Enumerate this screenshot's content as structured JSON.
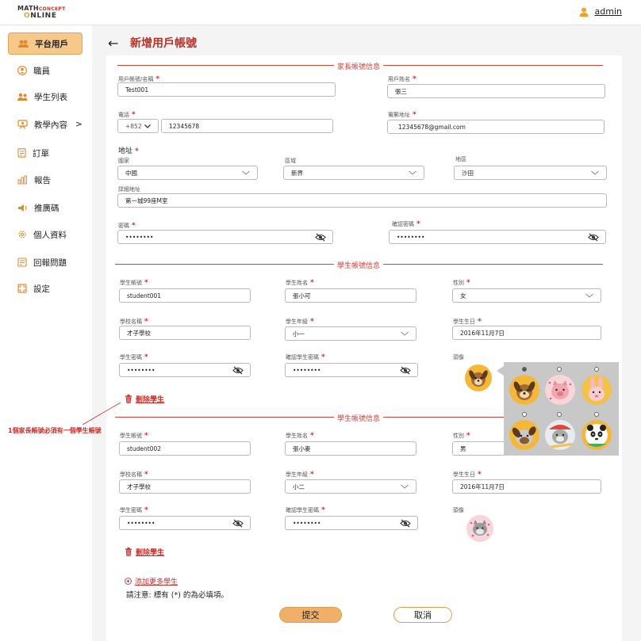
{
  "header": {
    "logo_line1_a": "MATH",
    "logo_line1_b": "CONCEPT",
    "logo_line2": "NLINE",
    "logo_line2_o": "O",
    "user_name": "admin"
  },
  "sidebar": {
    "items": [
      {
        "label": "平台用戶",
        "icon": "users-icon"
      },
      {
        "label": "職員",
        "icon": "staff-icon"
      },
      {
        "label": "學生列表",
        "icon": "students-icon"
      },
      {
        "label": "教學內容",
        "icon": "teaching-icon",
        "suffix": ">"
      },
      {
        "label": "訂單",
        "icon": "order-icon"
      },
      {
        "label": "報告",
        "icon": "report-icon"
      },
      {
        "label": "推廣碼",
        "icon": "promo-icon"
      },
      {
        "label": "個人資料",
        "icon": "profile-icon"
      },
      {
        "label": "回報問題",
        "icon": "feedback-icon"
      },
      {
        "label": "設定",
        "icon": "settings-icon"
      }
    ]
  },
  "page": {
    "back": "←",
    "title": "新增用戶帳號"
  },
  "parent": {
    "section_title": "家長帳號信息",
    "account_label": "用戶帳號/名稱",
    "account_value": "Test001",
    "name_label": "用戶姓名",
    "name_value": "張三",
    "phone_label": "電話",
    "phone_code": "+852",
    "phone_value": "12345678",
    "email_label": "電郵地址",
    "email_value": "12345678@gmail.com",
    "address_label": "地址",
    "country_label": "國家",
    "country_value": "中國",
    "region_label": "區域",
    "region_value": "新界",
    "district_label": "地區",
    "district_value": "沙田",
    "detail_label": "詳細地址",
    "detail_value": "第一城99座M室",
    "password_label": "密碼",
    "password_value": "••••••••",
    "confirm_label": "確認密碼",
    "confirm_value": "••••••••"
  },
  "students": [
    {
      "section_title": "學生帳號信息",
      "account_label": "學生帳號",
      "account_value": "student001",
      "name_label": "學生姓名",
      "name_value": "張小可",
      "gender_label": "性別",
      "gender_value": "女",
      "school_label": "學校名稱",
      "school_value": "才子學校",
      "grade_label": "學生年級",
      "grade_value": "小一",
      "birthday_label": "學生生日",
      "birthday_value": "2016年11月7日",
      "password_label": "學生密碼",
      "password_value": "••••••••",
      "confirm_label": "確認學生密碼",
      "confirm_value": "••••••••",
      "avatar_label": "頭像",
      "delete_label": "刪除學生"
    },
    {
      "section_title": "學生帳號信息",
      "account_label": "學生帳號",
      "account_value": "student002",
      "name_label": "學生姓名",
      "name_value": "張小麥",
      "gender_label": "性別",
      "gender_value": "男",
      "school_label": "學校名稱",
      "school_value": "才子學校",
      "grade_label": "學生年級",
      "grade_value": "小二",
      "birthday_label": "學生生日",
      "birthday_value": "2016年11月7日",
      "password_label": "學生密碼",
      "password_value": "••••••••",
      "confirm_label": "確認學生密碼",
      "confirm_value": "••••••••",
      "avatar_label": "頭像",
      "delete_label": "刪除學生"
    }
  ],
  "add_more_label": "添加更多學生",
  "required_note": "請注意: 標有 (*) 的為必填項。",
  "submit_label": "提交",
  "cancel_label": "取消",
  "annotation": "1個家長帳號必須有一個學生帳號",
  "required_mark": "*",
  "colors": {
    "accent": "#c9453b",
    "button": "#f0b06a",
    "sidebar_active": "#f6c88a"
  }
}
